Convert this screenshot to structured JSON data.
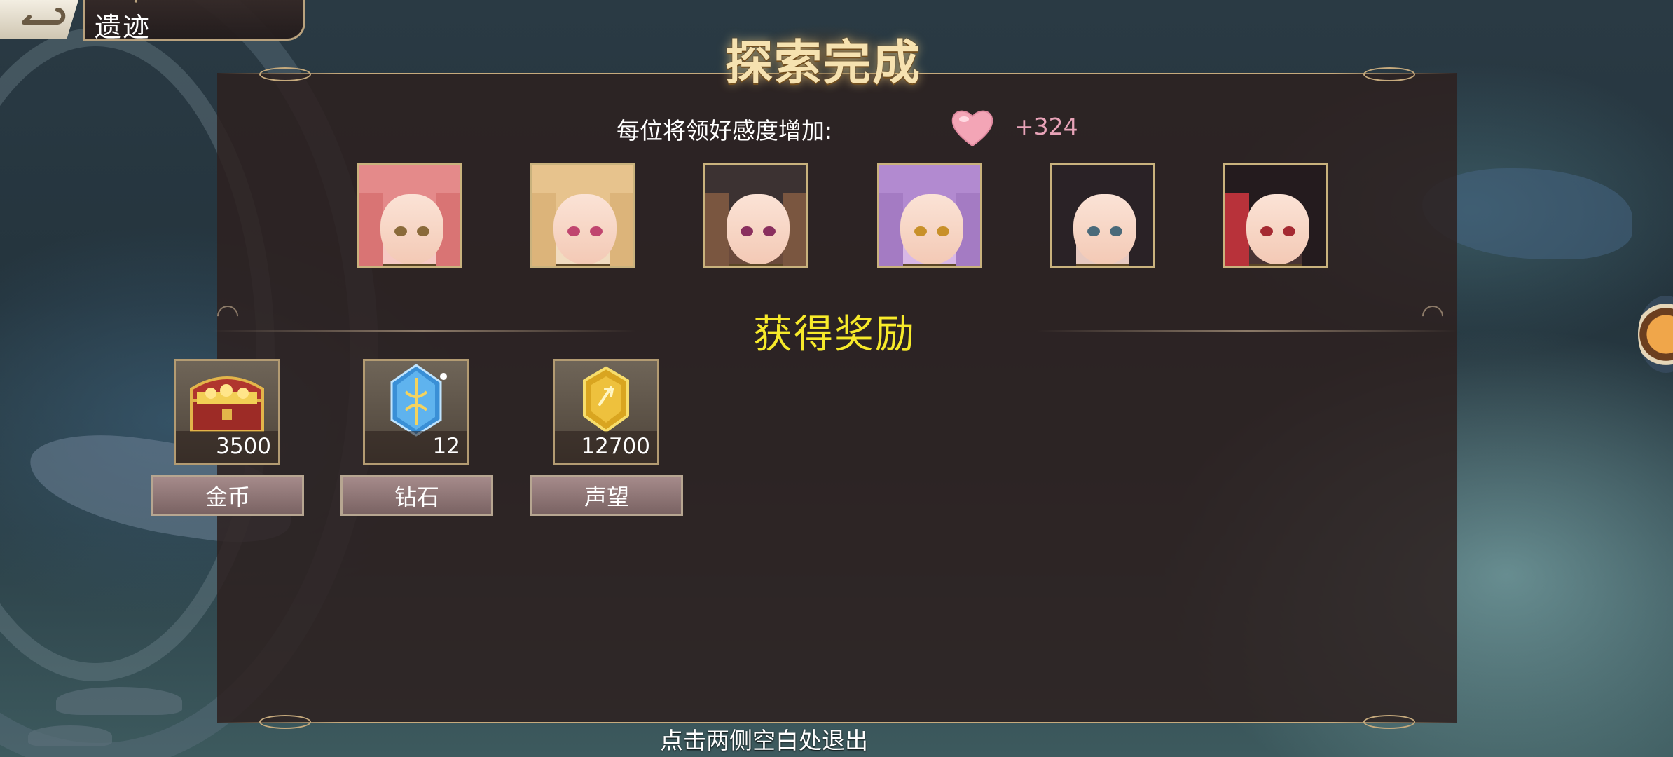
{
  "header": {
    "title": "遗迹"
  },
  "dialog": {
    "headline": "探索完成",
    "affinity_label": "每位将领好感度增加:",
    "affinity_value": "+324",
    "portraits": [
      {
        "name": "pink-haired"
      },
      {
        "name": "blonde"
      },
      {
        "name": "brunette"
      },
      {
        "name": "lavender-haired"
      },
      {
        "name": "black-haired"
      },
      {
        "name": "dark-red-haired"
      }
    ],
    "reward_title": "获得奖励",
    "rewards": [
      {
        "label": "金币",
        "count": "3500",
        "icon": "treasure-chest-icon"
      },
      {
        "label": "钻石",
        "count": "12",
        "icon": "diamond-crystal-icon"
      },
      {
        "label": "声望",
        "count": "12700",
        "icon": "gold-badge-icon"
      }
    ],
    "exit_hint": "点击两侧空白处退出"
  },
  "colors": {
    "reward_title": "#f7ea2a",
    "affinity_value": "#e8a3b8",
    "gold_trim": "#c6aa7d"
  }
}
